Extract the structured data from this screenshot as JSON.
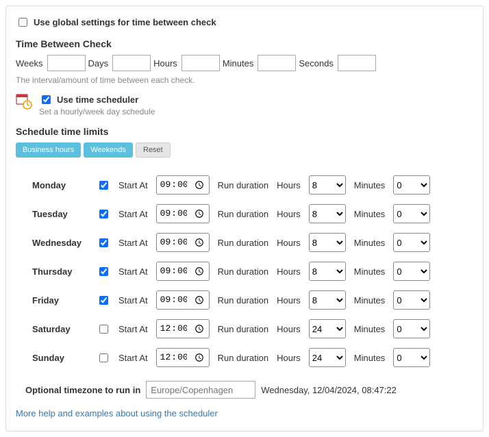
{
  "global": {
    "use_global_label": "Use global settings for time between check",
    "use_global_checked": false
  },
  "interval": {
    "title": "Time Between Check",
    "weeks_label": "Weeks",
    "days_label": "Days",
    "hours_label": "Hours",
    "minutes_label": "Minutes",
    "seconds_label": "Seconds",
    "weeks": "",
    "days": "",
    "hours": "",
    "minutes": "",
    "seconds": "",
    "hint": "The interval/amount of time between each check."
  },
  "scheduler": {
    "use_label": "Use time scheduler",
    "use_checked": true,
    "sub": "Set a hourly/week day schedule",
    "limits_title": "Schedule time limits",
    "btn_business": "Business hours",
    "btn_weekends": "Weekends",
    "btn_reset": "Reset",
    "col_start": "Start At",
    "col_run": "Run duration",
    "col_hours": "Hours",
    "col_minutes": "Minutes",
    "days": [
      {
        "name": "Monday",
        "enabled": true,
        "start": "09:00",
        "hours": "8",
        "minutes": "0"
      },
      {
        "name": "Tuesday",
        "enabled": true,
        "start": "09:00",
        "hours": "8",
        "minutes": "0"
      },
      {
        "name": "Wednesday",
        "enabled": true,
        "start": "09:00",
        "hours": "8",
        "minutes": "0"
      },
      {
        "name": "Thursday",
        "enabled": true,
        "start": "09:00",
        "hours": "8",
        "minutes": "0"
      },
      {
        "name": "Friday",
        "enabled": true,
        "start": "09:00",
        "hours": "8",
        "minutes": "0"
      },
      {
        "name": "Saturday",
        "enabled": false,
        "start": "00:00",
        "hours": "24",
        "minutes": "0"
      },
      {
        "name": "Sunday",
        "enabled": false,
        "start": "00:00",
        "hours": "24",
        "minutes": "0"
      }
    ]
  },
  "timezone": {
    "label": "Optional timezone to run in",
    "placeholder": "Europe/Copenhagen",
    "value": "",
    "now": "Wednesday, 12/04/2024, 08:47:22"
  },
  "help_link": "More help and examples about using the scheduler"
}
